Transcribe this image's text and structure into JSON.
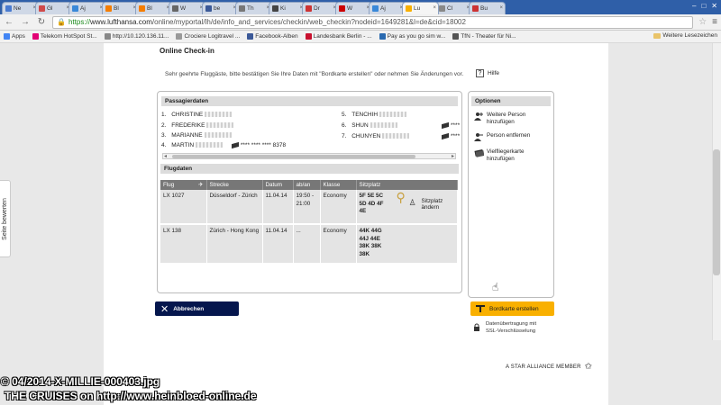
{
  "browser": {
    "tabs": [
      {
        "label": "Ne",
        "color": "#4a7bd0"
      },
      {
        "label": "Gl",
        "color": "#d04a4a"
      },
      {
        "label": "Aj",
        "color": "#3a88d8"
      },
      {
        "label": "Bl",
        "color": "#f57d00"
      },
      {
        "label": "Bl",
        "color": "#f57d00"
      },
      {
        "label": "W",
        "color": "#666666"
      },
      {
        "label": "be",
        "color": "#3b5998"
      },
      {
        "label": "Th",
        "color": "#777777"
      },
      {
        "label": "Ki",
        "color": "#444444"
      },
      {
        "label": "Dr",
        "color": "#cc3333"
      },
      {
        "label": "W",
        "color": "#cc0000"
      },
      {
        "label": "Aj",
        "color": "#3a88d8"
      },
      {
        "label": "Lu",
        "color": "#f9b000",
        "active": true
      },
      {
        "label": "Cl",
        "color": "#888888"
      },
      {
        "label": "Bu",
        "color": "#cc3333"
      }
    ],
    "url_scheme": "https://",
    "url_host": "www.lufthansa.com",
    "url_path": "/online/myportal/lh/de/info_and_services/checkin/web_checkin?nodeid=1649281&l=de&cid=18002",
    "bookmarks": [
      {
        "label": "Apps",
        "color": "#4285f4"
      },
      {
        "label": "Telekom HotSpot St...",
        "color": "#e20074"
      },
      {
        "label": "http://10.120.136.11...",
        "color": "#888888"
      },
      {
        "label": "Crociere Logitravel ...",
        "color": "#999999"
      },
      {
        "label": "Facebook-Alben",
        "color": "#3b5998"
      },
      {
        "label": "Landesbank Berlin - ...",
        "color": "#c8102e"
      },
      {
        "label": "Pay as you go sim w...",
        "color": "#2a6ab0"
      },
      {
        "label": "TfN - Theater für Ni...",
        "color": "#555555"
      }
    ],
    "bookmarks_other": "Weitere Lesezeichen"
  },
  "side_tab": "Seite bewerten",
  "page": {
    "title": "Online Check-in",
    "intro": "Sehr geehrte Fluggäste, bitte bestätigen Sie Ihre Daten mit \"Bordkarte erstellen\" oder nehmen Sie Änderungen vor.",
    "help": "Hilfe"
  },
  "passengers": {
    "heading": "Passagierdaten",
    "left": [
      {
        "num": "1.",
        "name": "CHRISTINE"
      },
      {
        "num": "2.",
        "name": "FREDERIKE"
      },
      {
        "num": "3.",
        "name": "MARIANNE"
      },
      {
        "num": "4.",
        "name": "MARTIN",
        "card": "**** **** **** 8378"
      }
    ],
    "right": [
      {
        "num": "5.",
        "name": "TENCHIH"
      },
      {
        "num": "6.",
        "name": "SHUN",
        "card": "****"
      },
      {
        "num": "7.",
        "name": "CHUNYEN",
        "card": "****"
      }
    ]
  },
  "flights": {
    "heading": "Flugdaten",
    "columns": [
      "Flug",
      "Strecke",
      "Datum",
      "ab/an",
      "Klasse",
      "Sitzplatz"
    ],
    "rows": [
      {
        "flight": "LX 1027",
        "route": "Düsseldorf - Zürich",
        "date": "11.04.14",
        "times": "19:50 - 21:00",
        "class": "Economy",
        "seats": "5F 5E 5C 5D 4D 4F 4E"
      },
      {
        "flight": "LX 138",
        "route": "Zürich - Hong Kong",
        "date": "11.04.14",
        "times": "...",
        "class": "Economy",
        "seats": "44K 44G 44J 44E 38K 38K 38K"
      }
    ],
    "seat_change": "Sitzplatz ändern"
  },
  "options": {
    "heading": "Optionen",
    "items": [
      "Weitere Person hinzufügen",
      "Person entfernen",
      "Vielfliegerkarte hinzufügen"
    ]
  },
  "buttons": {
    "cancel": "Abbrechen",
    "boarding": "Bordkarte erstellen"
  },
  "ssl_text": "Datenübertragung mit SSL-Verschlüsselung",
  "alliance": "A STAR ALLIANCE MEMBER",
  "watermark": {
    "line1": "© 04/2014-X-MILLIE-000403.jpg",
    "line2": "THE CRUISES on http://www.heinbloed-online.de"
  }
}
